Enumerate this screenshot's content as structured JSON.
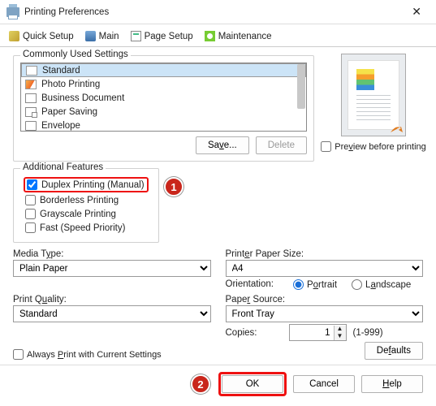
{
  "window": {
    "title": "Printing Preferences"
  },
  "tabs": {
    "quick": "Quick Setup",
    "main": "Main",
    "page_setup": "Page Setup",
    "maintenance": "Maintenance"
  },
  "common": {
    "legend": "Commonly Used Settings",
    "items": {
      "standard": "Standard",
      "photo": "Photo Printing",
      "business": "Business Document",
      "saver": "Paper Saving",
      "envelope": "Envelope"
    },
    "save_btn": "Save...",
    "delete_btn": "Delete"
  },
  "preview": {
    "checkbox": "Preview before printing"
  },
  "features": {
    "legend": "Additional Features",
    "duplex": "Duplex Printing (Manual)",
    "borderless": "Borderless Printing",
    "grayscale": "Grayscale Printing",
    "fast": "Fast (Speed Priority)"
  },
  "markers": {
    "one": "1",
    "two": "2"
  },
  "form": {
    "media_type_label": "Media Type:",
    "media_type_value": "Plain Paper",
    "print_quality_label": "Print Quality:",
    "print_quality_value": "Standard",
    "paper_size_label": "Printer Paper Size:",
    "paper_size_value": "A4",
    "orientation_label": "Orientation:",
    "portrait": "Portrait",
    "landscape": "Landscape",
    "paper_source_label": "Paper Source:",
    "paper_source_value": "Front Tray",
    "copies_label": "Copies:",
    "copies_value": "1",
    "copies_range": "(1-999)"
  },
  "always_print": "Always Print with Current Settings",
  "buttons": {
    "defaults": "Defaults",
    "ok": "OK",
    "cancel": "Cancel",
    "help": "Help"
  }
}
